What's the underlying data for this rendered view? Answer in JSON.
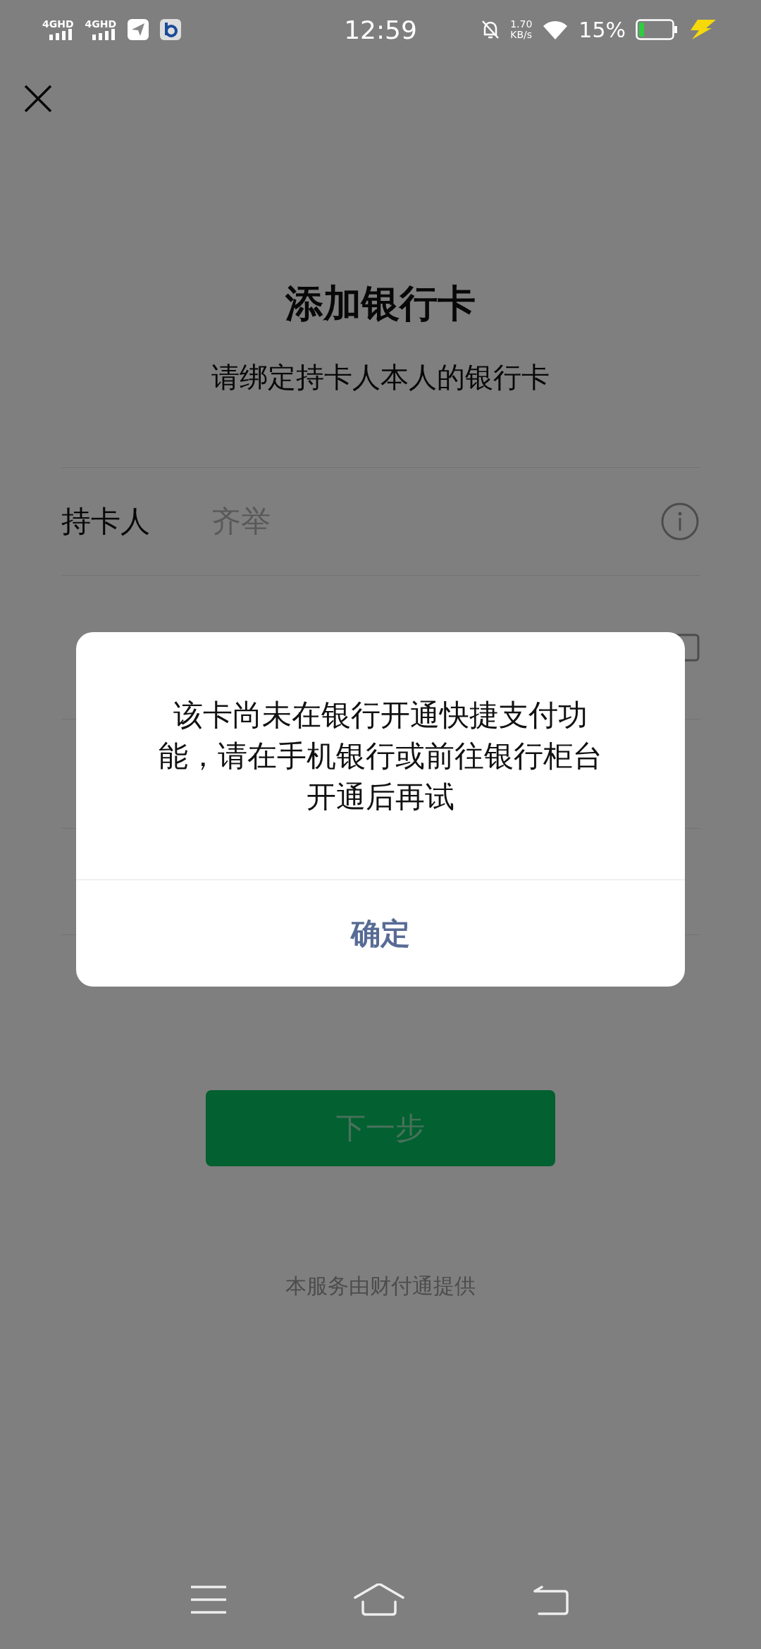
{
  "status_bar": {
    "networks": [
      "4GHD",
      "4GHD"
    ],
    "time": "12:59",
    "speed_value": "1.70",
    "speed_unit": "KB/s",
    "battery": "15%"
  },
  "title": "添加银行卡",
  "subtitle": "请绑定持卡人本人的银行卡",
  "form": [
    {
      "label": "持卡人",
      "value": "齐举"
    }
  ],
  "next_button": {
    "label": "下一步",
    "disabled": true
  },
  "footer": "本服务由财付通提供",
  "dialog": {
    "message": "该卡尚未在银行开通快捷支付功能，请在手机银行或前往银行柜台开通后再试",
    "confirm": "确定"
  }
}
